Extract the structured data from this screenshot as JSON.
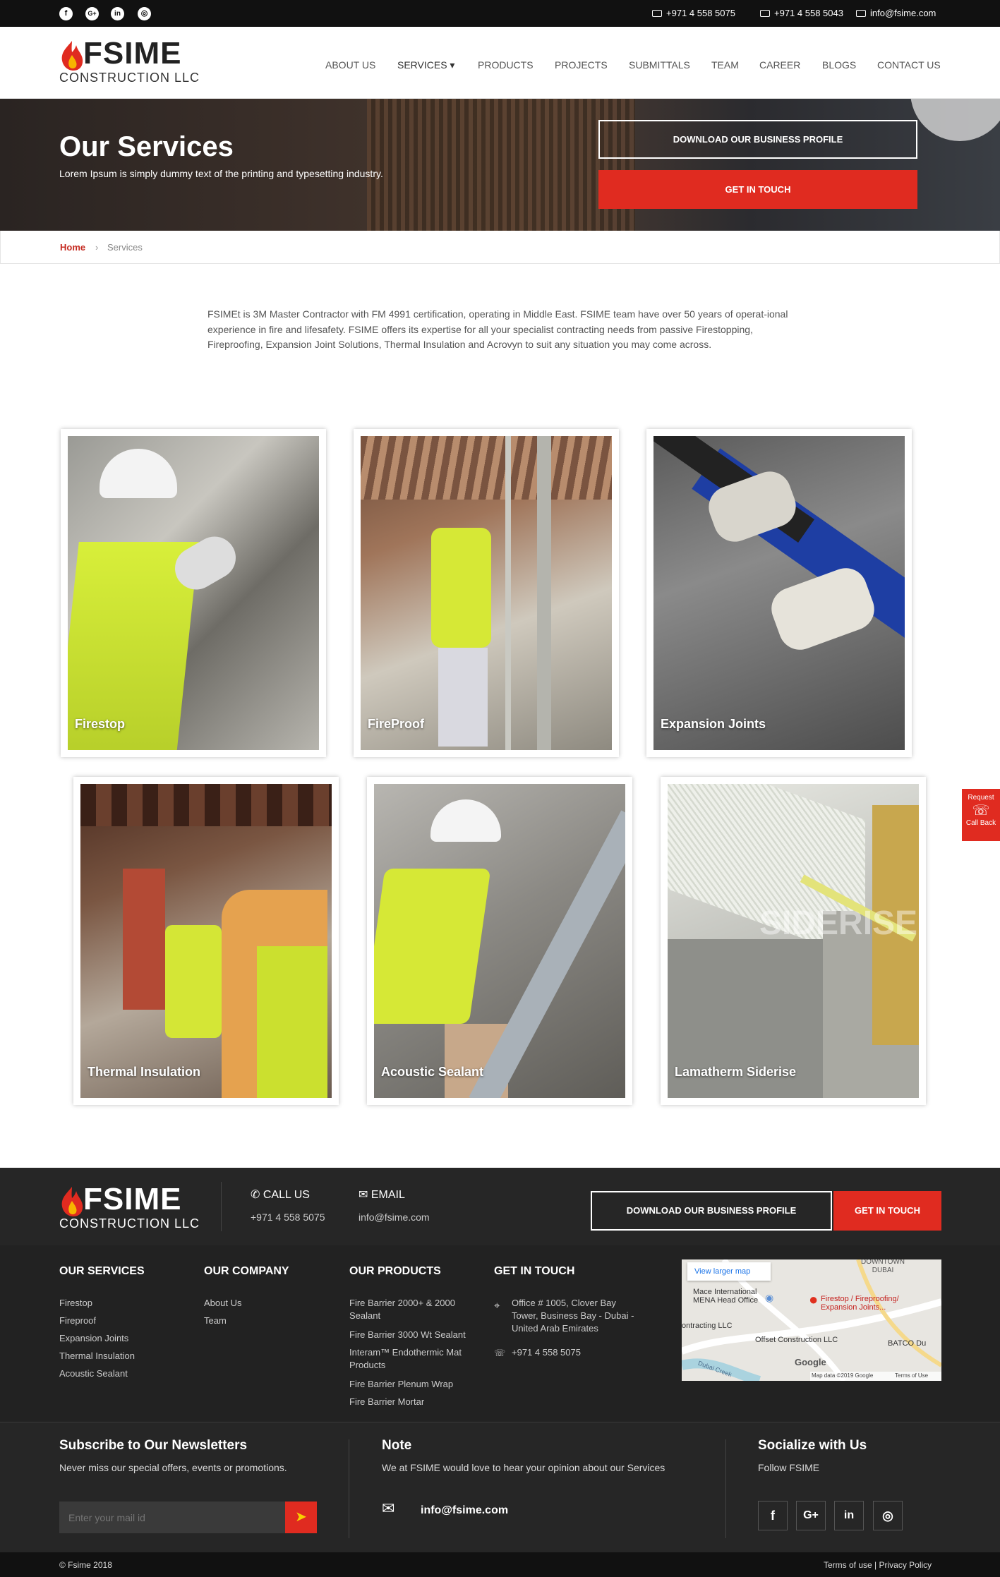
{
  "topbar": {
    "social": [
      "f",
      "G+",
      "in",
      "◎"
    ],
    "phone1": "+971 4 558 5075",
    "phone2": "+971 4 558 5043",
    "email": "info@fsime.com"
  },
  "brand": {
    "name": "FSIME",
    "sub": "CONSTRUCTION LLC"
  },
  "nav": [
    "ABOUT US",
    "SERVICES ▾",
    "PRODUCTS",
    "PROJECTS",
    "SUBMITTALS",
    "TEAM",
    "CAREER",
    "BLOGS",
    "CONTACT US"
  ],
  "hero": {
    "title": "Our Services",
    "subtitle": "Lorem Ipsum is simply dummy text of the printing and typesetting industry.",
    "download_btn": "DOWNLOAD OUR BUSINESS PROFILE",
    "touch_btn": "GET IN TOUCH"
  },
  "breadcrumb": {
    "home": "Home",
    "sep": "›",
    "current": "Services"
  },
  "intro": "FSIMEt is 3M Master Contractor with FM 4991 certification, operating in Middle East. FSIME team have over 50 years of operat-ional experience in fire and lifesafety. FSIME offers its expertise for all your specialist contracting needs from passive Firestopping, Fireproofing, Expansion Joint Solutions, Thermal Insulation and Acrovyn to suit any situation you may come across.",
  "services": [
    "Firestop",
    "FireProof",
    "Expansion Joints",
    "Thermal Insulation",
    "Acoustic Sealant",
    "Lamatherm Siderise"
  ],
  "side_badge": {
    "line1": "Request",
    "line2": "Call Back"
  },
  "footer": {
    "call_label": "CALL US",
    "call_value": "+971 4 558 5075",
    "email_label": "EMAIL",
    "email_value": "info@fsime.com",
    "download_btn": "DOWNLOAD OUR BUSINESS PROFILE",
    "touch_btn": "GET IN TOUCH",
    "services_title": "OUR SERVICES",
    "services": [
      "Firestop",
      "Fireproof",
      "Expansion Joints",
      "Thermal Insulation",
      "Acoustic Sealant"
    ],
    "company_title": "OUR COMPANY",
    "company": [
      "About Us",
      "Team"
    ],
    "products_title": "OUR PRODUCTS",
    "products": [
      "Fire Barrier 2000+ & 2000 Sealant",
      "Fire Barrier 3000 Wt Sealant",
      "Interam™ Endothermic Mat Products",
      "Fire Barrier Plenum Wrap",
      "Fire Barrier Mortar"
    ],
    "touch_title": "GET IN TOUCH",
    "address": "Office # 1005, Clover Bay Tower, Business Bay - Dubai - United Arab Emirates",
    "phone": "+971 4 558 5075",
    "map": {
      "link": "View larger map",
      "office": "Mace International MENA Head Office",
      "pin": "Firestop / Fireproofing/ Expansion Joints...",
      "offset": "Offset Construction LLC",
      "contracting": "ontracting LLC",
      "batco": "BATCO Du",
      "downtown": "DOWNTOWN DUBAI",
      "creek": "Dubai Creek",
      "google": "Google",
      "mapdata": "Map data ©2019 Google",
      "terms": "Terms of Use"
    },
    "subscribe_title": "Subscribe to Our Newsletters",
    "subscribe_text": "Never miss our special offers, events or promotions.",
    "subscribe_placeholder": "Enter your mail id",
    "note_title": "Note",
    "note_text": "We at FSIME would love to hear your opinion about our Services",
    "note_email": "info@fsime.com",
    "social_title": "Socialize with Us",
    "social_text": "Follow FSIME",
    "social": [
      "f",
      "G+",
      "in",
      "◎"
    ],
    "copyright": "© Fsime 2018",
    "legal": "Terms of use | Privacy Policy"
  },
  "colors": {
    "accent": "#e02b20",
    "dark": "#222222"
  }
}
